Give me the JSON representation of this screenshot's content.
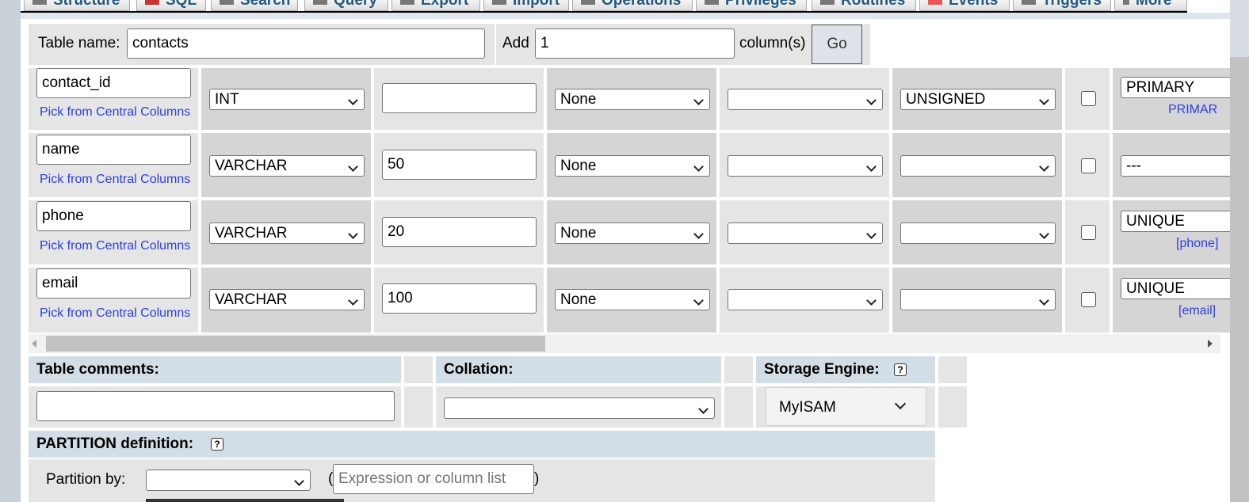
{
  "tabs": [
    {
      "label": "Structure",
      "icon": "structure-icon"
    },
    {
      "label": "SQL",
      "icon": "sql-icon"
    },
    {
      "label": "Search",
      "icon": "search-icon"
    },
    {
      "label": "Query",
      "icon": "query-icon"
    },
    {
      "label": "Export",
      "icon": "export-icon"
    },
    {
      "label": "Import",
      "icon": "import-icon"
    },
    {
      "label": "Operations",
      "icon": "operations-icon"
    },
    {
      "label": "Privileges",
      "icon": "privileges-icon"
    },
    {
      "label": "Routines",
      "icon": "routines-icon"
    },
    {
      "label": "Events",
      "icon": "events-icon"
    },
    {
      "label": "Triggers",
      "icon": "triggers-icon"
    },
    {
      "label": "More",
      "icon": "more-icon"
    }
  ],
  "header": {
    "table_name_label": "Table name:",
    "table_name_value": "contacts",
    "add_label": "Add",
    "add_value": "1",
    "columns_label": "column(s)",
    "go_label": "Go"
  },
  "columns": [
    {
      "name": "contact_id",
      "pick": "Pick from Central Columns",
      "type": "INT",
      "length": "",
      "default": "None",
      "collation": "",
      "attributes": "UNSIGNED",
      "index": "PRIMARY",
      "index_link": "PRIMAR"
    },
    {
      "name": "name",
      "pick": "Pick from Central Columns",
      "type": "VARCHAR",
      "length": "50",
      "default": "None",
      "collation": "",
      "attributes": "",
      "index": "---",
      "index_link": ""
    },
    {
      "name": "phone",
      "pick": "Pick from Central Columns",
      "type": "VARCHAR",
      "length": "20",
      "default": "None",
      "collation": "",
      "attributes": "",
      "index": "UNIQUE",
      "index_link": "[phone]"
    },
    {
      "name": "email",
      "pick": "Pick from Central Columns",
      "type": "VARCHAR",
      "length": "100",
      "default": "None",
      "collation": "",
      "attributes": "",
      "index": "UNIQUE",
      "index_link": "[email]"
    }
  ],
  "footer": {
    "table_comments_label": "Table comments:",
    "table_comments_value": "",
    "collation_label": "Collation:",
    "collation_value": "",
    "storage_engine_label": "Storage Engine:",
    "storage_engine_value": "MyISAM",
    "partition_label": "PARTITION definition:",
    "partition_by_label": "Partition by:",
    "partition_by_value": "",
    "open_paren": "(",
    "close_paren": ")",
    "expression_placeholder": "Expression or column list"
  }
}
